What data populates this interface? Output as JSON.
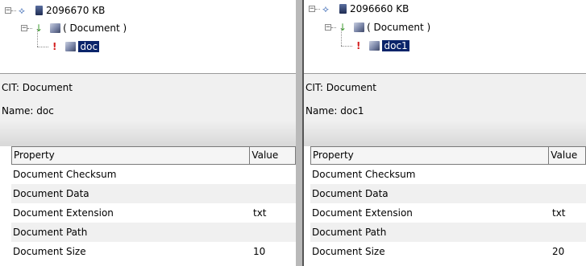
{
  "left": {
    "tree": {
      "size_label": "2096670 KB",
      "doc_node": "( Document )",
      "leaf": "doc"
    },
    "info": {
      "cit": "CIT: Document",
      "name": "Name: doc"
    },
    "grid": {
      "headers": {
        "property": "Property",
        "value": "Value"
      },
      "rows": [
        {
          "property": "Document Checksum",
          "value": ""
        },
        {
          "property": "Document Data",
          "value": ""
        },
        {
          "property": "Document Extension",
          "value": "txt"
        },
        {
          "property": "Document Path",
          "value": ""
        },
        {
          "property": "Document Size",
          "value": "10"
        }
      ]
    }
  },
  "right": {
    "tree": {
      "size_label": "2096660 KB",
      "doc_node": "( Document )",
      "leaf": "doc1"
    },
    "info": {
      "cit": "CIT: Document",
      "name": "Name: doc1"
    },
    "grid": {
      "headers": {
        "property": "Property",
        "value": "Value"
      },
      "rows": [
        {
          "property": "Document Checksum",
          "value": ""
        },
        {
          "property": "Document Data",
          "value": ""
        },
        {
          "property": "Document Extension",
          "value": "txt"
        },
        {
          "property": "Document Path",
          "value": ""
        },
        {
          "property": "Document Size",
          "value": "20"
        }
      ]
    }
  },
  "colors": {
    "selection": "#0a246a",
    "alt_row": "#f0f0f0",
    "panel_bg": "#f0f0f0"
  }
}
